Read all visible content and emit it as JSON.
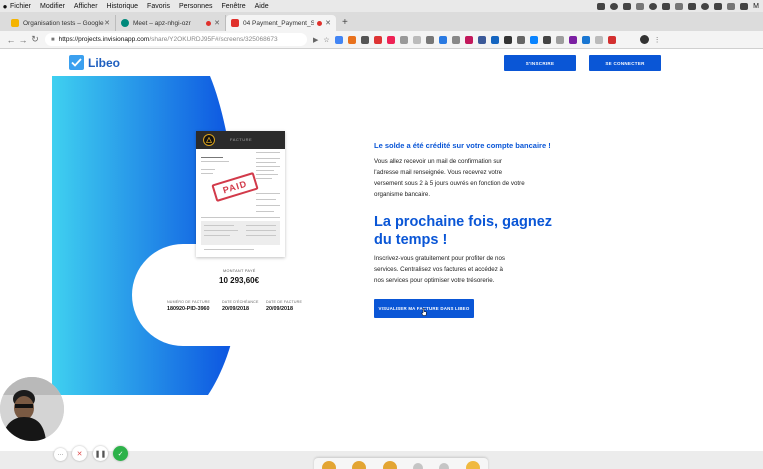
{
  "menubar": {
    "items": [
      "Fichier",
      "Modifier",
      "Afficher",
      "Historique",
      "Favoris",
      "Personnes",
      "Fenêtre",
      "Aide"
    ],
    "user_initial": "M"
  },
  "tabs": [
    {
      "title": "Organisation tests – Google Sh",
      "favicon_color": "#f4b400",
      "close": "✕"
    },
    {
      "title": "Meet – apz-nhgi-ozr",
      "favicon_color": "#00897b",
      "close": "✕",
      "recording": true
    },
    {
      "title": "04 Payment_Payment_Suc",
      "favicon_color": "#e0312c",
      "close": "✕",
      "recording": true,
      "active": true
    }
  ],
  "new_tab": "+",
  "address": {
    "host": "https://projects.invisionapp.com",
    "path": "/share/Y2OKURDJ95F#/screens/325068673"
  },
  "header": {
    "logo": "Libeo",
    "signup": "S'INSCRIRE",
    "login": "SE CONNECTER"
  },
  "invoice": {
    "head_label": "FACTURE",
    "stamp": "PAID",
    "amount_label": "MONTANT PAYÉ",
    "amount": "10 293,60€",
    "meta": [
      {
        "label": "NUMÉRO DE FACTURE",
        "value": "180920-PID-3960"
      },
      {
        "label": "DATE D'ÉCHÉANCE",
        "value": "20/09/2018"
      },
      {
        "label": "DATE DE FACTURE",
        "value": "20/09/2018"
      }
    ]
  },
  "content": {
    "success_title": "Le solde a été crédité sur votre compte bancaire !",
    "success_lines": [
      "Vous allez recevoir un mail de confirmation sur",
      "l'adresse mail renseignée. Vous recevrez votre",
      "versement sous 2 à 5 jours ouvrés en fonction de votre",
      "organisme bancaire."
    ],
    "big_title_1": "La prochaine fois, gagnez",
    "big_title_2": "du temps !",
    "promo_lines": [
      "Inscrivez-vous gratuitement pour profiter de nos",
      "services. Centralisez vos factures et accédez à",
      "nos services pour optimiser votre trésorerie."
    ],
    "cta": "VISUALISER MA FACTURE DANS LIBEO"
  },
  "recorder": {
    "dots": "···",
    "cancel": "✕",
    "pause": "❚❚",
    "done": "✓"
  },
  "colors": {
    "brand": "#0a56d6",
    "gradient_start": "#3fd0f0",
    "gradient_end": "#0a4fe0",
    "stamp": "#d23a4a"
  }
}
